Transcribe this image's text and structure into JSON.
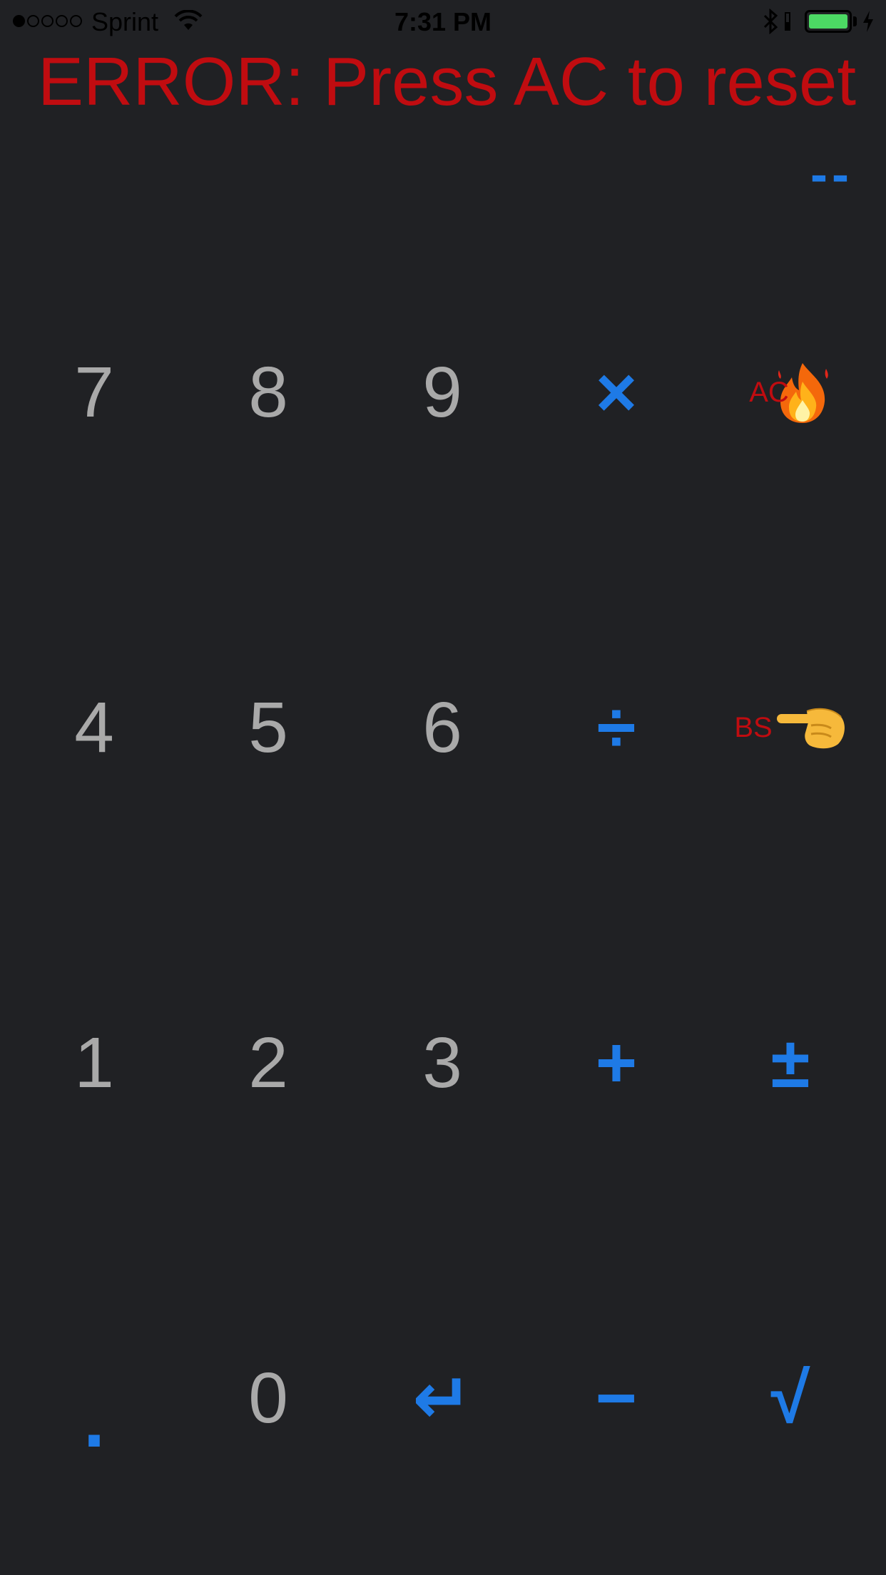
{
  "status_bar": {
    "carrier": "Sprint",
    "time": "7:31 PM",
    "signal_bars_filled": 1,
    "signal_bars_total": 5,
    "battery_level": 1.0,
    "battery_color": "#4cd964",
    "icons": [
      "signal-dots-icon",
      "wifi-icon",
      "bluetooth-icon",
      "battery-icon",
      "charging-icon"
    ]
  },
  "display": {
    "error_message": "ERROR: Press AC to reset",
    "value": "--",
    "error_color": "#c00c10",
    "accent_color": "#1e7ae6"
  },
  "keypad": {
    "rows": [
      [
        {
          "label": "7"
        },
        {
          "label": "8"
        },
        {
          "label": "9"
        },
        {
          "label": "×"
        },
        {
          "label": "AC",
          "emoji": "fire-emoji-icon"
        }
      ],
      [
        {
          "label": "4"
        },
        {
          "label": "5"
        },
        {
          "label": "6"
        },
        {
          "label": "÷"
        },
        {
          "label": "BS",
          "emoji": "backhand-index-pointing-left-icon"
        }
      ],
      [
        {
          "label": "1"
        },
        {
          "label": "2"
        },
        {
          "label": "3"
        },
        {
          "label": "+"
        },
        {
          "label": "±"
        }
      ],
      [
        {
          "label": "."
        },
        {
          "label": "0"
        },
        {
          "label": "↵"
        },
        {
          "label": "−"
        },
        {
          "label": "√"
        }
      ]
    ]
  }
}
